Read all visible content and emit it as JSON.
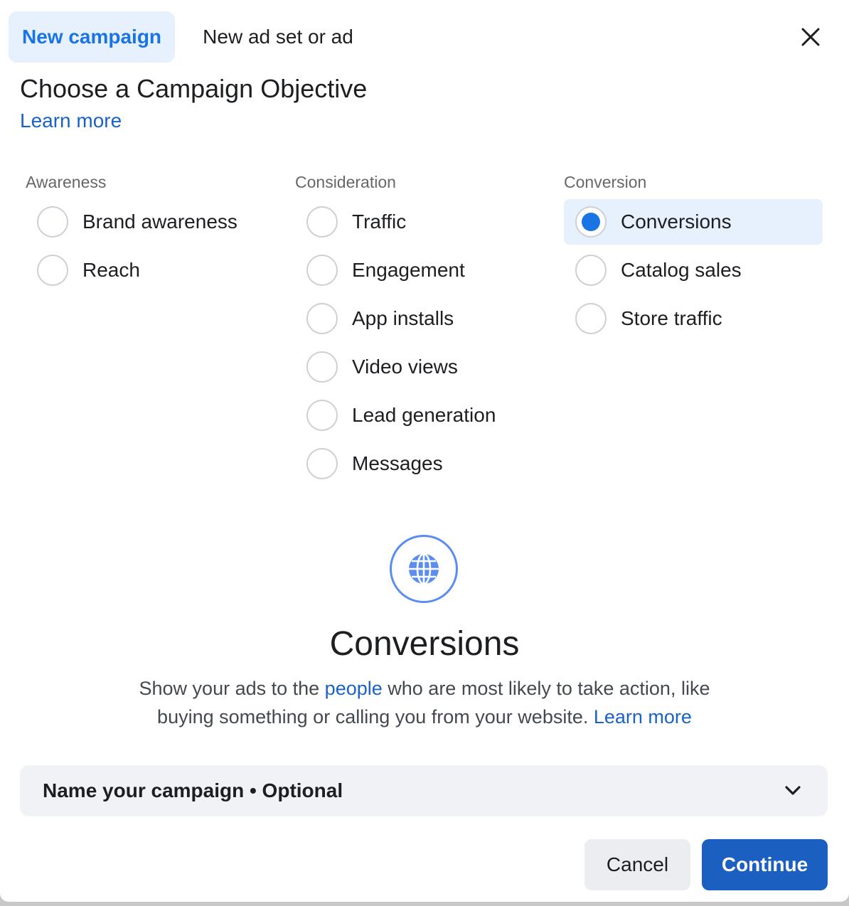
{
  "tabs": [
    {
      "label": "New campaign",
      "active": true
    },
    {
      "label": "New ad set or ad",
      "active": false
    }
  ],
  "heading": "Choose a Campaign Objective",
  "learn_more_top": "Learn more",
  "columns": {
    "awareness": {
      "heading": "Awareness",
      "options": [
        "Brand awareness",
        "Reach"
      ]
    },
    "consideration": {
      "heading": "Consideration",
      "options": [
        "Traffic",
        "Engagement",
        "App installs",
        "Video views",
        "Lead generation",
        "Messages"
      ]
    },
    "conversion": {
      "heading": "Conversion",
      "options": [
        "Conversions",
        "Catalog sales",
        "Store traffic"
      ]
    }
  },
  "selected_option": "Conversions",
  "detail": {
    "icon": "globe-icon",
    "title": "Conversions",
    "desc_part1": "Show your ads to the ",
    "desc_link1": "people",
    "desc_part2": " who are most likely to take action, like buying something or calling you from your website. ",
    "desc_link2": "Learn more"
  },
  "name_campaign": {
    "label": "Name your campaign • Optional"
  },
  "buttons": {
    "cancel": "Cancel",
    "continue": "Continue"
  },
  "colors": {
    "accent": "#1b74e4",
    "link": "#1b62c7",
    "continue_bg": "#1b5fc1",
    "selected_bg": "#e7f0fd"
  }
}
